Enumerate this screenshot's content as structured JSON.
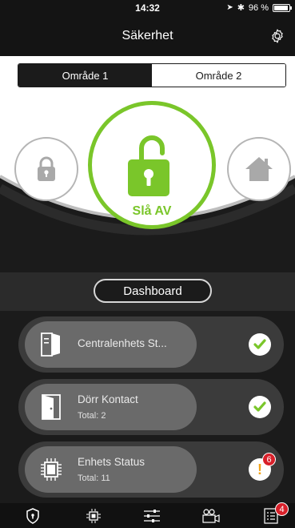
{
  "status_bar": {
    "time": "14:32",
    "battery": "96 %",
    "battery_level": 0.96
  },
  "nav": {
    "title": "Säkerhet",
    "settings_icon": "gear-icon"
  },
  "areas": {
    "tabs": [
      {
        "label": "Område 1",
        "selected": true
      },
      {
        "label": "Område 2",
        "selected": false
      }
    ]
  },
  "arming": {
    "main_label": "Slå AV",
    "main_icon": "unlocked-padlock-icon",
    "left_icon": "locked-padlock-icon",
    "right_icon": "home-icon",
    "accent_color": "#7ac62a"
  },
  "dashboard": {
    "label": "Dashboard",
    "cards": [
      {
        "title": "Centralenhets St...",
        "subtitle": "",
        "icon": "control-panel-icon",
        "status_icon": "checkmark-icon",
        "status_color": "#7ac62a"
      },
      {
        "title": "Dörr Kontact",
        "subtitle": "Total: 2",
        "icon": "door-icon",
        "status_icon": "checkmark-icon",
        "status_color": "#7ac62a"
      },
      {
        "title": "Enhets Status",
        "subtitle": "Total: 11",
        "icon": "chip-icon",
        "status_icon": "warning-icon",
        "status_color": "#f2a41a",
        "badge": "6"
      }
    ]
  },
  "tabbar": {
    "items": [
      {
        "icon": "shield-icon",
        "badge": ""
      },
      {
        "icon": "chip-icon",
        "badge": ""
      },
      {
        "icon": "sliders-icon",
        "badge": ""
      },
      {
        "icon": "camera-icon",
        "badge": ""
      },
      {
        "icon": "list-icon",
        "badge": "4"
      }
    ]
  }
}
